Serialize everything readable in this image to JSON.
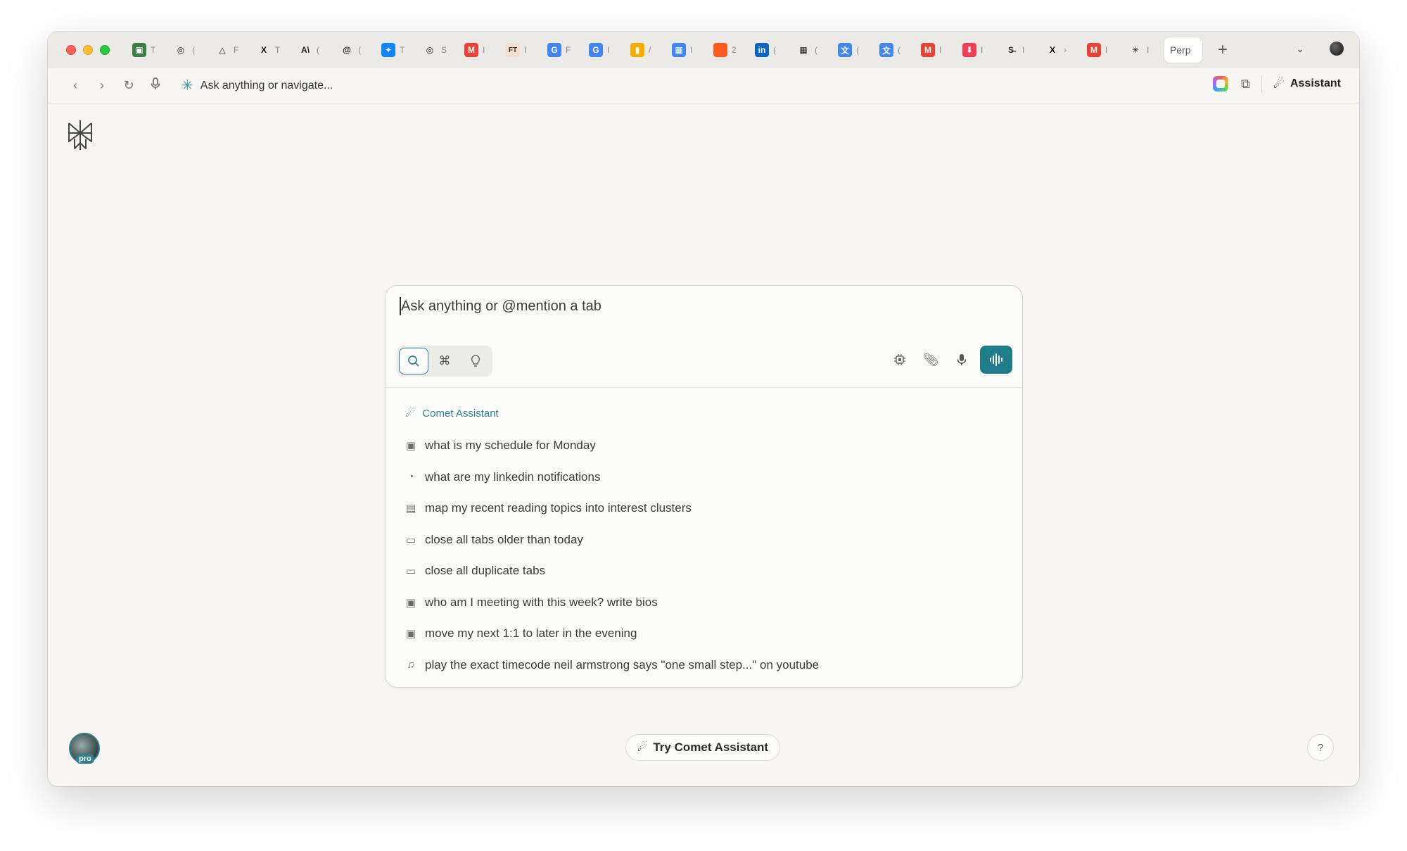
{
  "tabbar": {
    "tabs": [
      {
        "label": "T",
        "icon": "image-icon",
        "color": "#3a7d44",
        "glyph": "▣"
      },
      {
        "label": "(",
        "icon": "openai-icon",
        "color": "#111111",
        "glyph": "◎"
      },
      {
        "label": "F",
        "icon": "triangle-icon",
        "color": "#222222",
        "glyph": "△"
      },
      {
        "label": "T",
        "icon": "x-icon",
        "color": "#000000",
        "glyph": "X"
      },
      {
        "label": "(",
        "icon": "anthropic-icon",
        "color": "#222222",
        "glyph": "A\\"
      },
      {
        "label": "(",
        "icon": "threads-icon",
        "color": "#111111",
        "glyph": "@"
      },
      {
        "label": "T",
        "icon": "bluesky-icon",
        "color": "#1185fe",
        "glyph": "✦"
      },
      {
        "label": "S",
        "icon": "openai-icon",
        "color": "#111111",
        "glyph": "◎"
      },
      {
        "label": "I",
        "icon": "gmail-icon",
        "color": "#ea4335",
        "glyph": "M"
      },
      {
        "label": "I",
        "icon": "ft-icon",
        "color": "#f2dfce",
        "glyph": "FT"
      },
      {
        "label": "F",
        "icon": "google-icon",
        "color": "#4285f4",
        "glyph": "G"
      },
      {
        "label": "I",
        "icon": "google-icon",
        "color": "#4285f4",
        "glyph": "G"
      },
      {
        "label": "/",
        "icon": "analytics-icon",
        "color": "#f9ab00",
        "glyph": "▮"
      },
      {
        "label": "I",
        "icon": "calendar-icon",
        "color": "#4285f4",
        "glyph": "▦"
      },
      {
        "label": "2",
        "icon": "orange-square-icon",
        "color": "#ff5a1f",
        "glyph": ""
      },
      {
        "label": "(",
        "icon": "linkedin-icon",
        "color": "#0a66c2",
        "glyph": "in"
      },
      {
        "label": "(",
        "icon": "table-icon",
        "color": "#222222",
        "glyph": "▦"
      },
      {
        "label": "(",
        "icon": "translate-icon",
        "color": "#4285f4",
        "glyph": "文"
      },
      {
        "label": "(",
        "icon": "translate-icon",
        "color": "#4285f4",
        "glyph": "文"
      },
      {
        "label": "I",
        "icon": "gmail-icon",
        "color": "#ea4335",
        "glyph": "M"
      },
      {
        "label": "I",
        "icon": "pocket-icon",
        "color": "#ef3e56",
        "glyph": "⬇"
      },
      {
        "label": "I",
        "icon": "strikethrough-icon",
        "color": "#333333",
        "glyph": "S̶"
      },
      {
        "label": "›",
        "icon": "x-icon",
        "color": "#000000",
        "glyph": "X"
      },
      {
        "label": "I",
        "icon": "gmail-icon",
        "color": "#ea4335",
        "glyph": "M"
      },
      {
        "label": "I",
        "icon": "perplexity-icon",
        "color": "#111111",
        "glyph": "✳"
      }
    ],
    "active_tab": {
      "label": "Perp"
    },
    "new_tab": "+",
    "dropdown": "⌄"
  },
  "navbar": {
    "omnibox_placeholder": "Ask anything or navigate...",
    "assistant_label": "Assistant"
  },
  "search": {
    "placeholder": "Ask anything or @mention a tab",
    "suggestions_header": "Comet Assistant",
    "suggestions": [
      {
        "icon": "calendar-icon",
        "glyph": "▣",
        "text": "what is my schedule for Monday"
      },
      {
        "icon": "bell-icon",
        "glyph": "◔",
        "text": "what are my linkedin notifications"
      },
      {
        "icon": "doc-search-icon",
        "glyph": "▤",
        "text": "map my recent reading topics into interest clusters"
      },
      {
        "icon": "window-icon",
        "glyph": "▭",
        "text": "close all tabs older than today"
      },
      {
        "icon": "window-icon",
        "glyph": "▭",
        "text": "close all duplicate tabs"
      },
      {
        "icon": "calendar-icon",
        "glyph": "▣",
        "text": "who am I meeting with this week? write bios"
      },
      {
        "icon": "calendar-icon",
        "glyph": "▣",
        "text": "move my next 1:1 to later in the evening"
      },
      {
        "icon": "music-icon",
        "glyph": "♫",
        "text": "play the exact timecode neil armstrong says \"one small step...\" on youtube"
      }
    ]
  },
  "bottom": {
    "pro_badge": "pro",
    "try_label": "Try Comet Assistant",
    "help": "?"
  },
  "colors": {
    "accent": "#207c8a",
    "background": "#f7f6f2"
  }
}
